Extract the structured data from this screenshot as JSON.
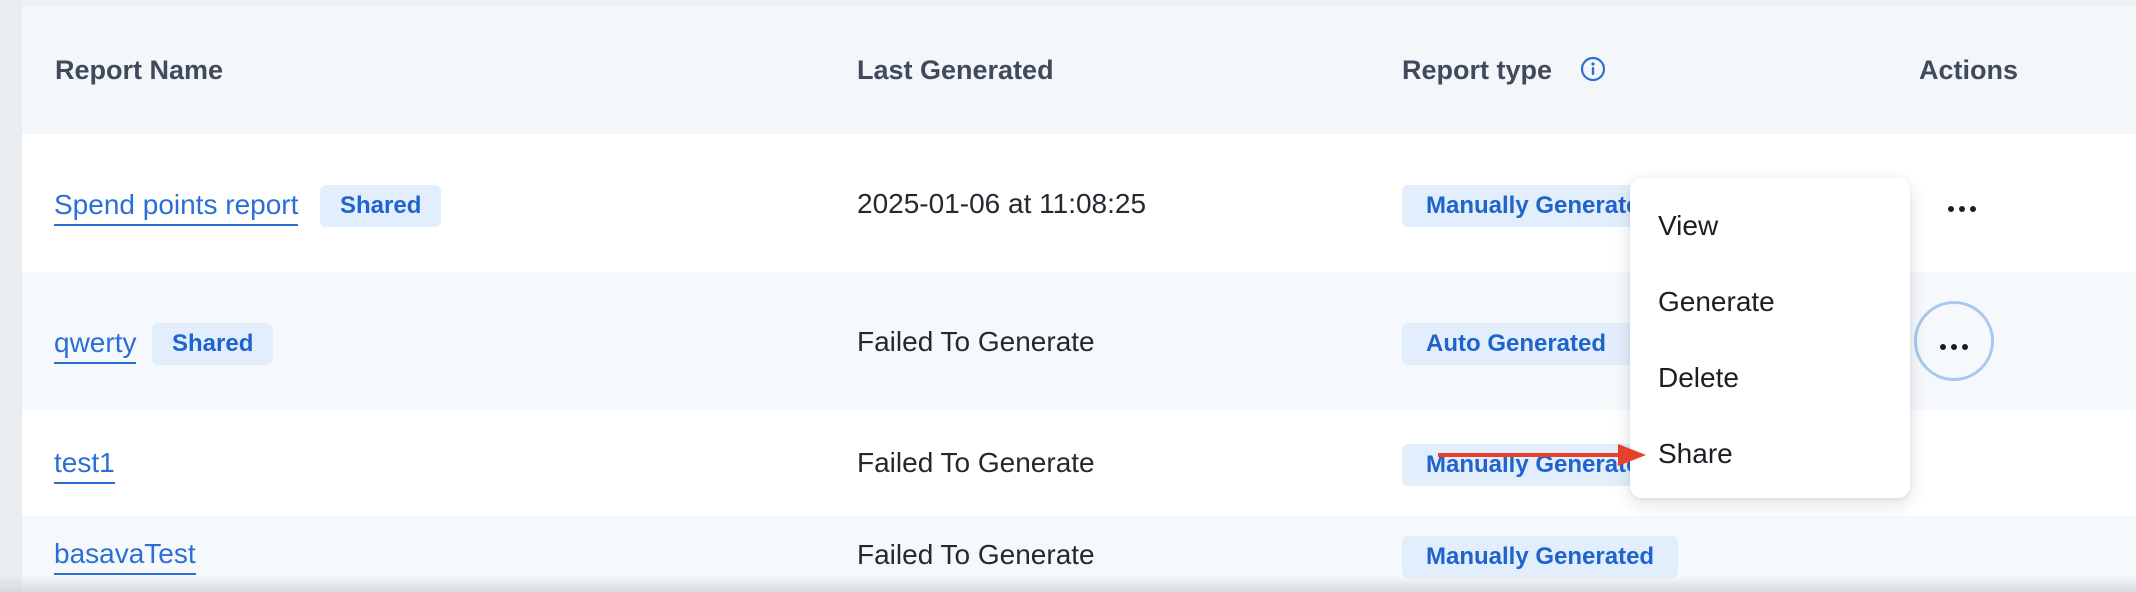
{
  "table": {
    "headers": {
      "report_name": "Report Name",
      "last_generated": "Last Generated",
      "report_type": "Report type",
      "actions": "Actions"
    },
    "rows": [
      {
        "name": "Spend points report",
        "shared_badge": "Shared",
        "last_generated": "2025-01-06 at 11:08:25",
        "report_type": "Manually Generated"
      },
      {
        "name": "qwerty",
        "shared_badge": "Shared",
        "last_generated": "Failed To Generate",
        "report_type": "Auto Generated"
      },
      {
        "name": "test1",
        "shared_badge": "",
        "last_generated": "Failed To Generate",
        "report_type": "Manually Generated"
      },
      {
        "name": "basavaTest",
        "shared_badge": "",
        "last_generated": "Failed To Generate",
        "report_type": "Manually Generated"
      }
    ]
  },
  "actions_menu": {
    "items": [
      "View",
      "Generate",
      "Delete",
      "Share"
    ]
  },
  "icons": {
    "info": "info-circle-icon",
    "more": "more-horizontal-icon",
    "annotation": "red-arrow-icon"
  },
  "colors": {
    "link": "#2b6fd6",
    "badge_bg": "#e3eefc",
    "badge_text": "#1f63cc",
    "annotation_arrow": "#e8402a",
    "active_ring": "#a8c8f0"
  }
}
